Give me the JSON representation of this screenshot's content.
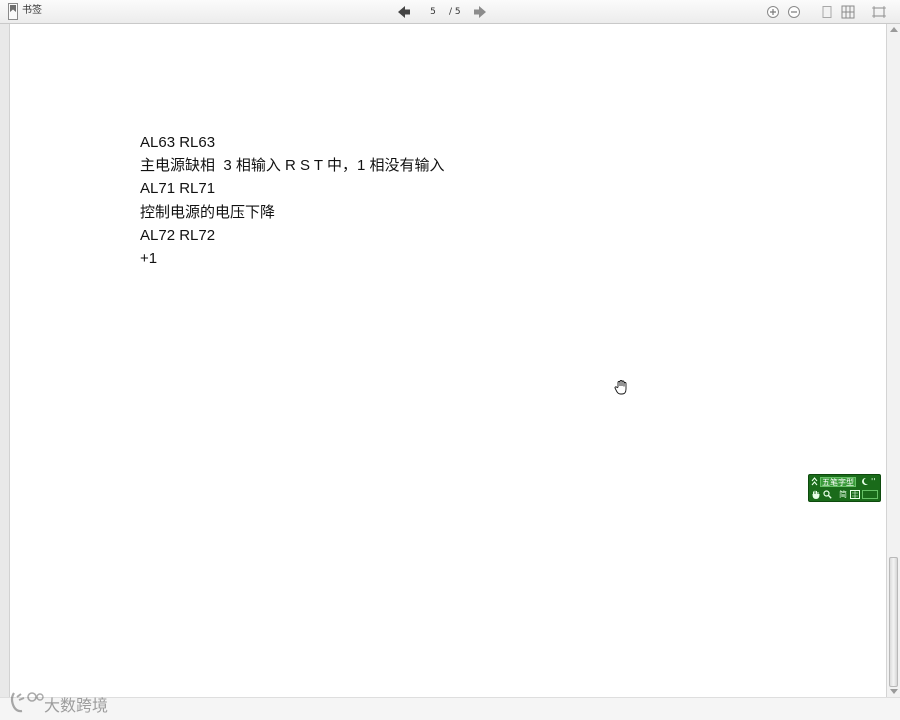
{
  "toolbar": {
    "bookmark_label": "书签",
    "page_current": "5",
    "page_total": "/ 5",
    "icons": [
      "bookmark-icon",
      "prev-page-icon",
      "next-page-icon",
      "zoom-in-icon",
      "zoom-out-icon",
      "single-page-icon",
      "grid-view-icon",
      "fit-page-icon"
    ]
  },
  "document": {
    "lines": [
      "AL63 RL63",
      "主电源缺相  3 相输入 R S T 中，1 相没有输入",
      "AL71 RL71",
      "控制电源的电压下降",
      "AL72 RL72",
      "+1"
    ]
  },
  "ime": {
    "name": "五笔字型",
    "mode": "简",
    "punct": "''",
    "icons": [
      "ime-logo-icon",
      "half-moon-icon",
      "hand-icon",
      "soft-keyboard-icon"
    ]
  },
  "watermark": {
    "text": "大数跨境"
  },
  "colors": {
    "toolbar_bg": "#ececec",
    "nav_arrow": "#4a4a4a",
    "ime_green": "#1a6b1a",
    "page_bg": "#ffffff"
  }
}
